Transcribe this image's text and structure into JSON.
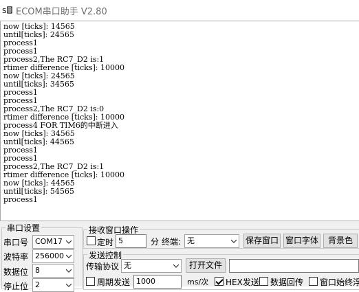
{
  "window": {
    "title": "ECOM串口助手   V2.80"
  },
  "receive": {
    "lines": [
      "now [ticks]: 14565",
      "until[ticks]: 24565",
      "process1",
      "process1",
      "process2,The RC7_D2 is:1",
      "rtimer difference [ticks]: 10000",
      "now [ticks]: 24565",
      "until[ticks]: 34565",
      "process1",
      "process1",
      "process2,The RC7_D2 is:0",
      "rtimer difference [ticks]: 10000",
      "process4 FOR TIM6的中断进入",
      "now [ticks]: 34565",
      "until[ticks]: 44565",
      "process1",
      "process1",
      "process2,The RC7_D2 is:1",
      "rtimer difference [ticks]: 10000",
      "now [ticks]: 44565",
      "until[ticks]: 54565",
      "process1"
    ]
  },
  "serial_settings": {
    "legend": "串口设置",
    "port_label": "串口号",
    "port_value": "COM17",
    "baud_label": "波特率",
    "baud_value": "256000",
    "databits_label": "数据位",
    "databits_value": "8",
    "stopbits_label": "停止位",
    "stopbits_value": "2"
  },
  "recv_ops": {
    "legend": "接收窗口操作",
    "timed_label": "定时",
    "timed_value": "5",
    "minutes_label": "分",
    "terminator_label": "终端:",
    "terminator_value": "无",
    "save_window": "保存窗口",
    "window_font": "窗口字体",
    "background": "背景色"
  },
  "send_ctrl": {
    "legend": "发送控制",
    "protocol_label": "传输协议",
    "protocol_value": "无",
    "open_file": "打开文件",
    "file_path": "",
    "periodic_label": "周期发送",
    "period_value": "1000",
    "period_unit": "ms/次",
    "hex_send_label": "HEX发送",
    "echo_label": "数据回传",
    "always_label": "窗口始终浮"
  }
}
